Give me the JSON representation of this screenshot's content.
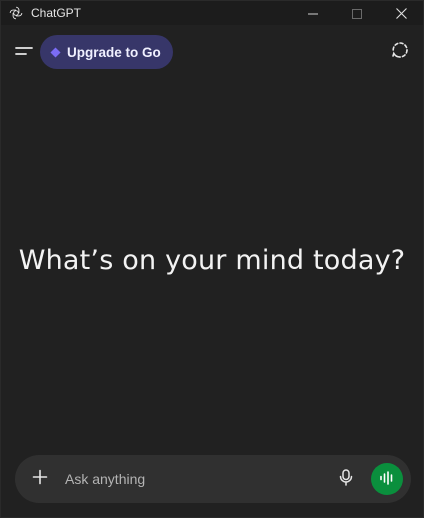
{
  "window": {
    "title": "ChatGPT",
    "icons": {
      "logo": "openai-logo-icon",
      "minimize": "minimize-icon",
      "maximize": "maximize-icon",
      "close": "close-icon"
    }
  },
  "toolbar": {
    "menu_icon": "sidebar-toggle-icon",
    "upgrade_label": "Upgrade to Go",
    "upgrade_icon": "diamond-icon",
    "temp_chat_icon": "temporary-chat-icon"
  },
  "main": {
    "headline": "What’s on your mind today?"
  },
  "composer": {
    "placeholder": "Ask anything",
    "value": "",
    "plus_icon": "plus-icon",
    "mic_icon": "microphone-icon",
    "voice_icon": "voice-waveform-icon"
  },
  "colors": {
    "background": "#212121",
    "upgrade_pill": "#373669",
    "composer": "#303030",
    "voice_button": "#0a8f3d"
  }
}
